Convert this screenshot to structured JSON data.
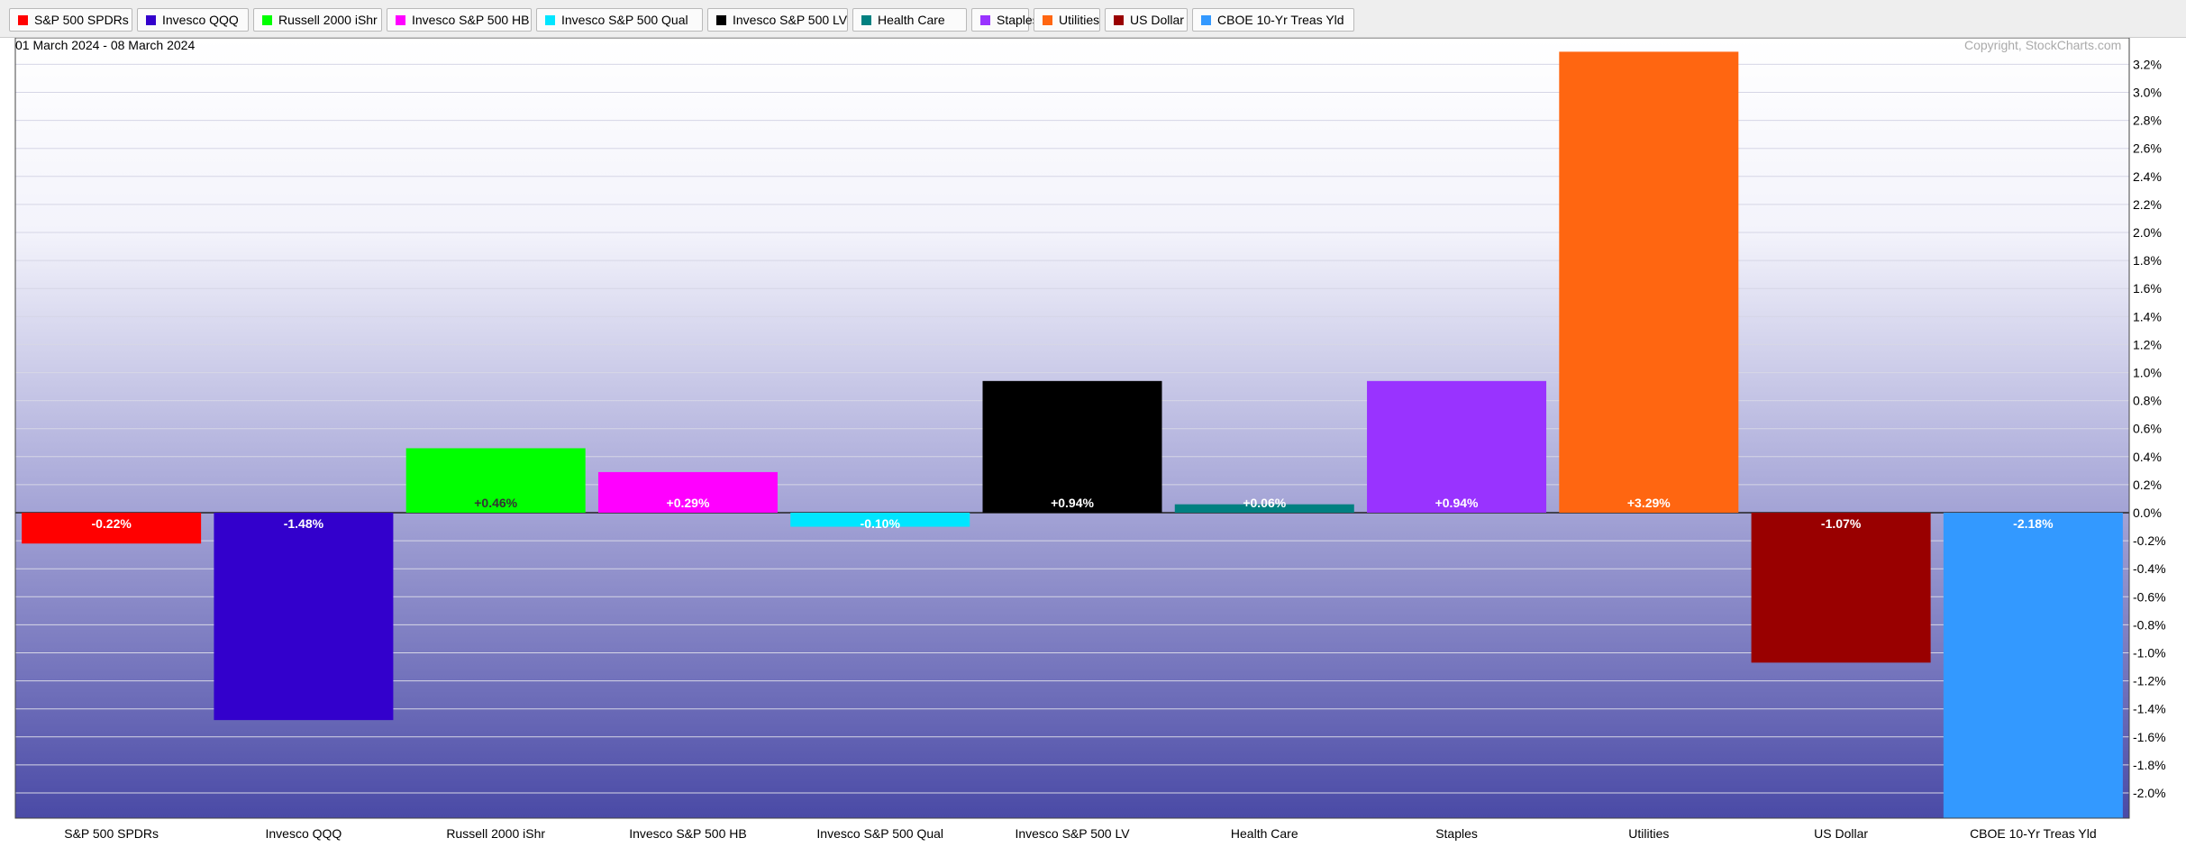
{
  "legend": [
    {
      "label": "S&P 500 SPDRs",
      "color": "#ff0000"
    },
    {
      "label": "Invesco QQQ",
      "color": "#3300cc"
    },
    {
      "label": "Russell 2000 iShr",
      "color": "#00ff00"
    },
    {
      "label": "Invesco S&P 500 HB",
      "color": "#ff00ff"
    },
    {
      "label": "Invesco S&P 500 Qual",
      "color": "#00e5ff"
    },
    {
      "label": "Invesco S&P 500 LV",
      "color": "#000000"
    },
    {
      "label": "Health Care",
      "color": "#008080"
    },
    {
      "label": "Staples",
      "color": "#9933ff"
    },
    {
      "label": "Utilities",
      "color": "#ff6611"
    },
    {
      "label": "US Dollar",
      "color": "#990000"
    },
    {
      "label": "CBOE 10-Yr Treas Yld",
      "color": "#3399ff"
    }
  ],
  "date_range": "01 March 2024 - 08 March 2024",
  "copyright": "Copyright, StockCharts.com",
  "chart_data": {
    "type": "bar",
    "categories": [
      "S&P 500 SPDRs",
      "Invesco QQQ",
      "Russell 2000 iShr",
      "Invesco S&P 500 HB",
      "Invesco S&P 500 Qual",
      "Invesco S&P 500 LV",
      "Health Care",
      "Staples",
      "Utilities",
      "US Dollar",
      "CBOE 10-Yr Treas Yld"
    ],
    "values": [
      -0.22,
      -1.48,
      0.46,
      0.29,
      -0.1,
      0.94,
      0.06,
      0.94,
      3.29,
      -1.07,
      -2.18
    ],
    "data_labels": [
      "-0.22%",
      "-1.48%",
      "+0.46%",
      "+0.29%",
      "-0.10%",
      "+0.94%",
      "+0.06%",
      "+0.94%",
      "+3.29%",
      "-1.07%",
      "-2.18%"
    ],
    "colors": [
      "#ff0000",
      "#3300cc",
      "#00ff00",
      "#ff00ff",
      "#00e5ff",
      "#000000",
      "#008080",
      "#9933ff",
      "#ff6611",
      "#990000",
      "#3399ff"
    ],
    "y_ticks": [
      3.2,
      3.0,
      2.8,
      2.6,
      2.4,
      2.2,
      2.0,
      1.8,
      1.6,
      1.4,
      1.2,
      1.0,
      0.8,
      0.6,
      0.4,
      0.2,
      0.0,
      -0.2,
      -0.4,
      -0.6,
      -0.8,
      -1.0,
      -1.2,
      -1.4,
      -1.6,
      -1.8,
      -2.0
    ],
    "y_tick_labels": [
      "3.2%",
      "3.0%",
      "2.8%",
      "2.6%",
      "2.4%",
      "2.2%",
      "2.0%",
      "1.8%",
      "1.6%",
      "1.4%",
      "1.2%",
      "1.0%",
      "0.8%",
      "0.6%",
      "0.4%",
      "0.2%",
      "0.0%",
      "-0.2%",
      "-0.4%",
      "-0.6%",
      "-0.8%",
      "-1.0%",
      "-1.2%",
      "-1.4%",
      "-1.6%",
      "-1.8%",
      "-2.0%"
    ],
    "ylim": [
      -2.18,
      3.29
    ],
    "grid": true
  }
}
